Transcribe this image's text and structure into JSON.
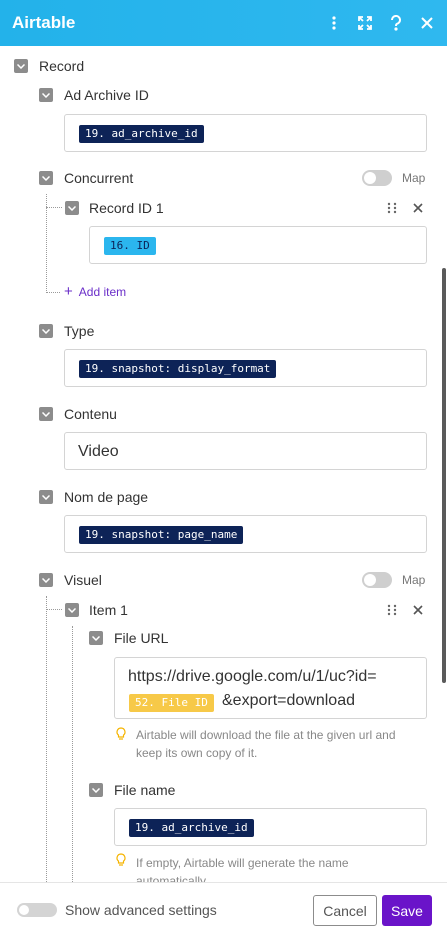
{
  "header": {
    "title": "Airtable",
    "icons": [
      "more-vertical-icon",
      "expand-icon",
      "help-icon",
      "close-icon"
    ],
    "background": "#2bb4ec"
  },
  "record": {
    "label": "Record",
    "ad_archive_id": {
      "label": "Ad Archive ID",
      "pill": "19. ad_archive_id"
    },
    "concurrent": {
      "label": "Concurrent",
      "map_label": "Map",
      "item": {
        "label": "Record ID 1",
        "pill": "16. ID"
      },
      "add_item": "Add item"
    },
    "type": {
      "label": "Type",
      "pill": "19. snapshot: display_format"
    },
    "contenu": {
      "label": "Contenu",
      "value": "Video"
    },
    "nom_de_page": {
      "label": "Nom de page",
      "pill": "19. snapshot: page_name"
    },
    "visuel": {
      "label": "Visuel",
      "map_label": "Map",
      "item": {
        "label": "Item 1",
        "file_url": {
          "label": "File URL",
          "line1": "https://drive.google.com/u/1/uc?id=",
          "pill": "52. File ID",
          "suffix": "&export=download",
          "hint": "Airtable will download the file at the given url and keep its own copy of it."
        },
        "file_name": {
          "label": "File name",
          "pill": "19. ad_archive_id",
          "hint": "If empty, Airtable will generate the name automatically."
        }
      }
    }
  },
  "footer": {
    "advanced_label": "Show advanced settings",
    "cancel_label": "Cancel",
    "save_label": "Save",
    "save_color": "#6a14c9"
  }
}
